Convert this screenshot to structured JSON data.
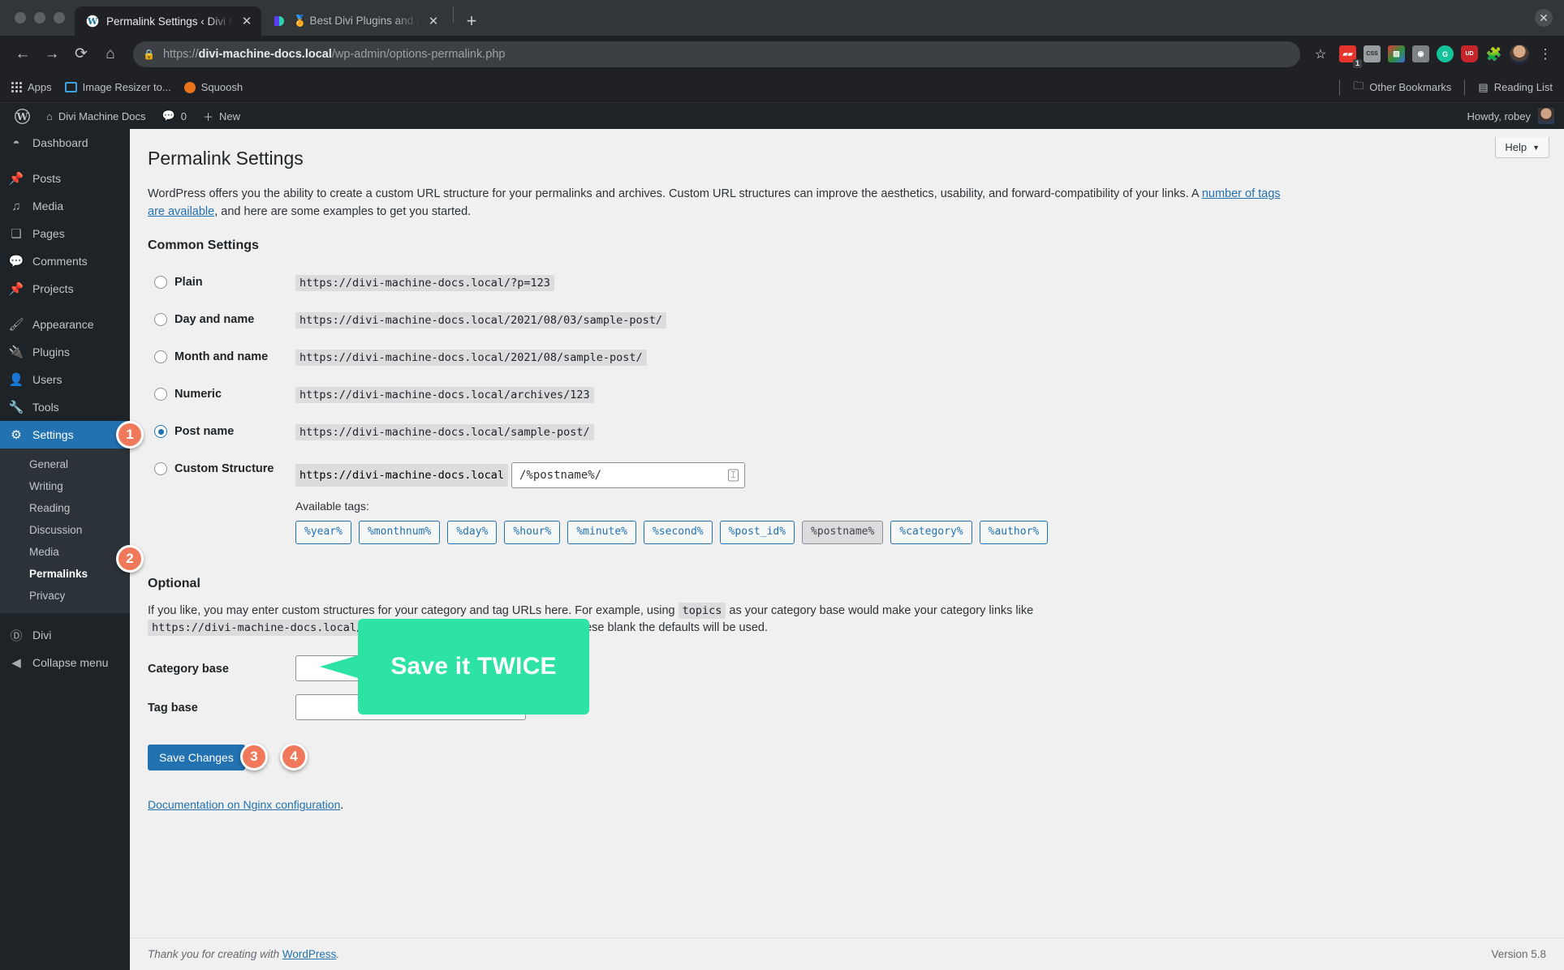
{
  "browser": {
    "tabs": [
      {
        "title": "Permalink Settings ‹ Divi Machine Docs",
        "favicon": "wordpress-icon",
        "active": true,
        "close_label": "✕"
      },
      {
        "title": "🏅 Best Divi Plugins and Premium Divi",
        "favicon": "divi-icon",
        "active": false,
        "close_label": "✕"
      }
    ],
    "new_tab_label": "+",
    "window_close_label": "✕",
    "nav": {
      "back": "←",
      "forward": "→",
      "reload": "⟳",
      "home": "⌂"
    },
    "omnibox": {
      "lock_icon": "lock-icon",
      "url_scheme": "https://",
      "url_host": "divi-machine-docs.local",
      "url_path": "/wp-admin/options-permalink.php",
      "star_icon": "star-icon"
    },
    "extensions": [
      {
        "name": "recording-extension",
        "glyph": "▮▮",
        "color": "#e5342b",
        "badge": "1"
      },
      {
        "name": "css-extension",
        "glyph": "CSS",
        "color": "#8a8d90"
      },
      {
        "name": "image-extension",
        "glyph": "▨",
        "color": "#3d8b3d"
      },
      {
        "name": "camera-extension",
        "glyph": "◉",
        "color": "#7a7d80"
      },
      {
        "name": "grammarly-extension",
        "glyph": "G",
        "color": "#15c39a"
      },
      {
        "name": "ud-extension",
        "glyph": "UD",
        "color": "#c6252c"
      },
      {
        "name": "puzzle-extensions-icon",
        "glyph": "✦",
        "color": "#7a7d80"
      }
    ],
    "profile_icon": "profile-avatar",
    "menu_icon": "kebab-menu-icon",
    "bookmarks": {
      "apps_label": "Apps",
      "items": [
        {
          "label": "Image Resizer to...",
          "icon": "image-resizer-icon"
        },
        {
          "label": "Squoosh",
          "icon": "squoosh-icon"
        }
      ],
      "other_bookmarks": "Other Bookmarks",
      "reading_list": "Reading List"
    }
  },
  "adminbar": {
    "logo": "wordpress-logo",
    "site_name": "Divi Machine Docs",
    "comments_count": "0",
    "new_label": "New",
    "howdy": "Howdy, robey"
  },
  "sidebar": {
    "items": [
      {
        "label": "Dashboard",
        "icon": "dashboard-icon",
        "current": false
      },
      {
        "label": "Posts",
        "icon": "pin-icon",
        "current": false
      },
      {
        "label": "Media",
        "icon": "media-icon",
        "current": false
      },
      {
        "label": "Pages",
        "icon": "pages-icon",
        "current": false
      },
      {
        "label": "Comments",
        "icon": "comment-icon",
        "current": false
      },
      {
        "label": "Projects",
        "icon": "pin-icon",
        "current": false
      },
      {
        "label": "Appearance",
        "icon": "brush-icon",
        "current": false
      },
      {
        "label": "Plugins",
        "icon": "plug-icon",
        "current": false
      },
      {
        "label": "Users",
        "icon": "user-icon",
        "current": false
      },
      {
        "label": "Tools",
        "icon": "wrench-icon",
        "current": false
      },
      {
        "label": "Settings",
        "icon": "settings-icon",
        "current": true
      }
    ],
    "submenu": [
      {
        "label": "General",
        "current": false
      },
      {
        "label": "Writing",
        "current": false
      },
      {
        "label": "Reading",
        "current": false
      },
      {
        "label": "Discussion",
        "current": false
      },
      {
        "label": "Media",
        "current": false
      },
      {
        "label": "Permalinks",
        "current": true
      },
      {
        "label": "Privacy",
        "current": false
      }
    ],
    "bottom": [
      {
        "label": "Divi",
        "icon": "divi-icon"
      },
      {
        "label": "Collapse menu",
        "icon": "collapse-icon"
      }
    ]
  },
  "page": {
    "help_label": "Help",
    "help_caret": "▼",
    "title": "Permalink Settings",
    "lead_part1": "WordPress offers you the ability to create a custom URL structure for your permalinks and archives. Custom URL structures can improve the aesthetics, usability, and forward-compatibility of your links. A ",
    "lead_link": "number of tags are available",
    "lead_part2": ", and here are some examples to get you started.",
    "common_settings_heading": "Common Settings",
    "options": [
      {
        "label": "Plain",
        "url": "https://divi-machine-docs.local/?p=123",
        "selected": false
      },
      {
        "label": "Day and name",
        "url": "https://divi-machine-docs.local/2021/08/03/sample-post/",
        "selected": false
      },
      {
        "label": "Month and name",
        "url": "https://divi-machine-docs.local/2021/08/sample-post/",
        "selected": false
      },
      {
        "label": "Numeric",
        "url": "https://divi-machine-docs.local/archives/123",
        "selected": false
      },
      {
        "label": "Post name",
        "url": "https://divi-machine-docs.local/sample-post/",
        "selected": true
      }
    ],
    "custom": {
      "label": "Custom Structure",
      "prefix": "https://divi-machine-docs.local",
      "value": "/%postname%/",
      "input_icon": "text-cursor-icon",
      "available_tags_label": "Available tags:",
      "tags": [
        {
          "label": "%year%",
          "disabled": false
        },
        {
          "label": "%monthnum%",
          "disabled": false
        },
        {
          "label": "%day%",
          "disabled": false
        },
        {
          "label": "%hour%",
          "disabled": false
        },
        {
          "label": "%minute%",
          "disabled": false
        },
        {
          "label": "%second%",
          "disabled": false
        },
        {
          "label": "%post_id%",
          "disabled": false
        },
        {
          "label": "%postname%",
          "disabled": true
        },
        {
          "label": "%category%",
          "disabled": false
        },
        {
          "label": "%author%",
          "disabled": false
        }
      ]
    },
    "optional": {
      "heading": "Optional",
      "text_part1": "If you like, you may enter custom structures for your category and tag URLs here. For example, using ",
      "code1": "topics",
      "text_part2": " as your category base would make your category links like ",
      "code2": "https://divi-machine-docs.local/topics/uncategorized/",
      "text_part3": ". If you leave these blank the defaults will be used.",
      "category_base_label": "Category base",
      "category_base_value": "",
      "tag_base_label": "Tag base",
      "tag_base_value": ""
    },
    "save_label": "Save Changes",
    "doc_link": "Documentation on Nginx configuration",
    "doc_period": "."
  },
  "annotations": {
    "pins": [
      {
        "number": "1",
        "target": "settings-menu"
      },
      {
        "number": "2",
        "target": "permalinks-submenu"
      },
      {
        "number": "3",
        "target": "save-changes-first"
      },
      {
        "number": "4",
        "target": "save-changes-second"
      }
    ],
    "callout_text": "Save it TWICE",
    "callout_color": "#2ce3a4",
    "pin_color": "#f0795b"
  },
  "footer": {
    "thanks_prefix": "Thank you for creating with ",
    "thanks_link": "WordPress",
    "thanks_suffix": ".",
    "version": "Version 5.8"
  }
}
